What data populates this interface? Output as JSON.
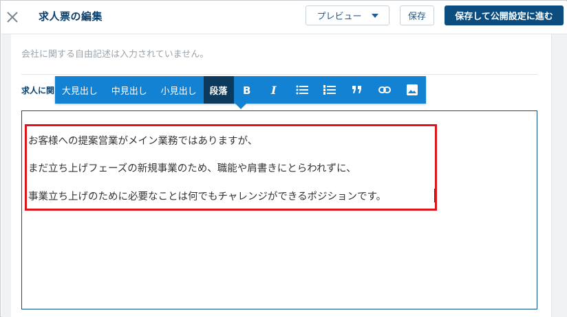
{
  "header": {
    "title": "求人票の編集",
    "preview_label": "プレビュー",
    "save_label": "保存",
    "publish_label": "保存して公開設定に進む"
  },
  "main": {
    "company_note": "会社に関する自由記述は入力されていません。",
    "section_label": "求人に関",
    "editor_lines": [
      "お客様への提案営業がメイン業務ではありますが、",
      "まだ立ち上げフェーズの新規事業のため、職能や肩書きにとらわれずに、",
      "事業立ち上げのために必要なことは何でもチャレンジができるポジションです。"
    ]
  },
  "toolbar": {
    "h1_label": "大見出し",
    "h2_label": "中見出し",
    "h3_label": "小見出し",
    "paragraph_label": "段落",
    "icons": [
      "bold-icon",
      "italic-icon",
      "bullet-list-icon",
      "numbered-list-icon",
      "quote-icon",
      "link-icon",
      "image-icon"
    ]
  },
  "colors": {
    "toolbar_bg": "#1482d2",
    "toolbar_active": "#0b3a5c",
    "primary_button": "#0b4d7e",
    "highlight_border": "#e0151a"
  }
}
